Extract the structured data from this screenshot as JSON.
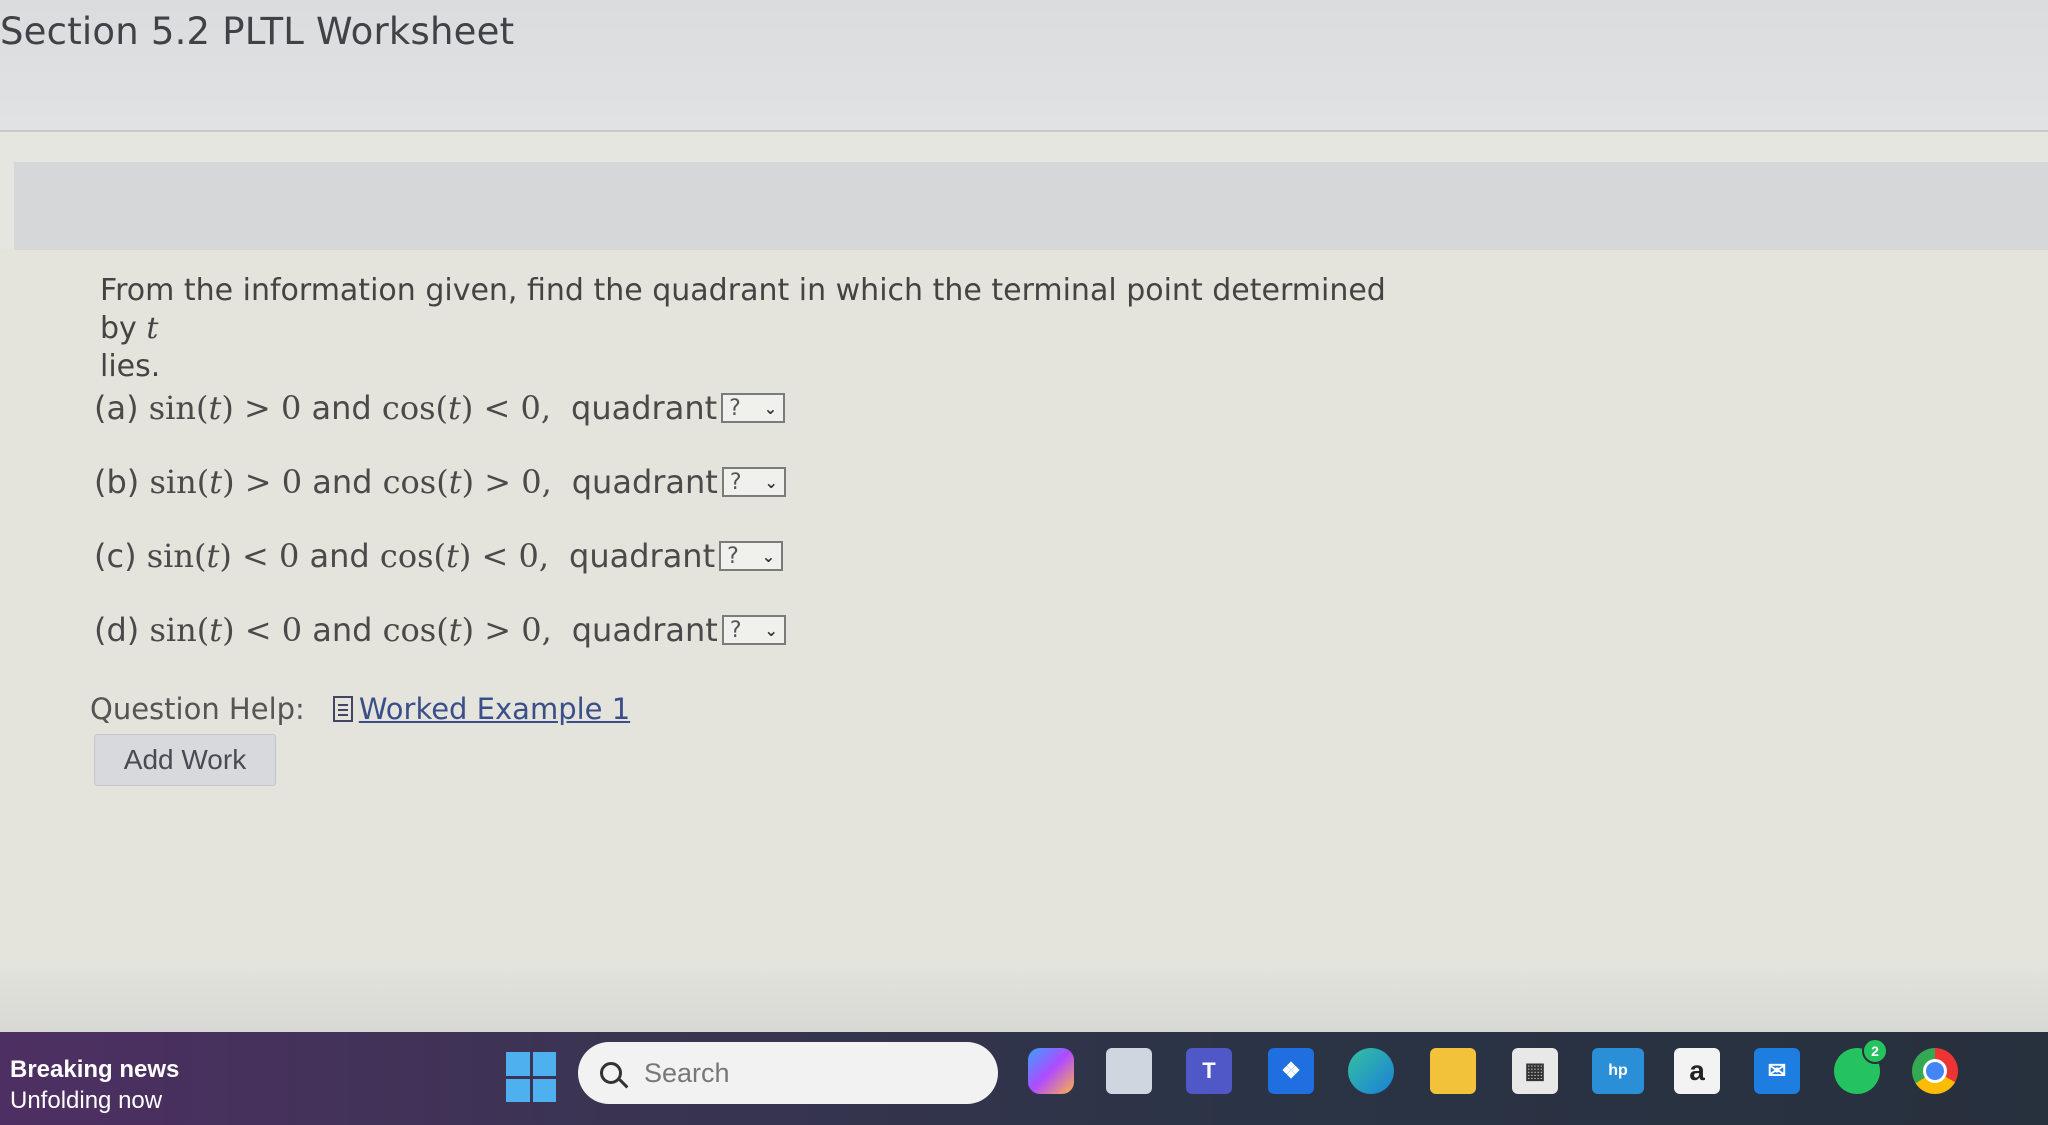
{
  "header": {
    "title": "Section 5.2 PLTL Worksheet"
  },
  "question": {
    "text": "From the information given, find the quadrant in which the terminal point determined by",
    "variable": "t",
    "text_end": "lies."
  },
  "parts": [
    {
      "label": "(a)",
      "sin_rel": ">",
      "cos_rel": "<",
      "quadrant_label": "quadrant",
      "selected": "?"
    },
    {
      "label": "(b)",
      "sin_rel": ">",
      "cos_rel": ">",
      "quadrant_label": "quadrant",
      "selected": "?"
    },
    {
      "label": "(c)",
      "sin_rel": "<",
      "cos_rel": "<",
      "quadrant_label": "quadrant",
      "selected": "?"
    },
    {
      "label": "(d)",
      "sin_rel": "<",
      "cos_rel": ">",
      "quadrant_label": "quadrant",
      "selected": "?"
    }
  ],
  "math": {
    "sin": "sin",
    "cos": "cos",
    "t": "t",
    "zero": "0",
    "and": "and",
    "zero_comma": "0,"
  },
  "help": {
    "label": "Question Help:",
    "link": "Worked Example 1",
    "icon": "document-icon"
  },
  "actions": {
    "add_work": "Add Work"
  },
  "taskbar": {
    "news_title": "Breaking news",
    "news_sub": "Unfolding now",
    "search_placeholder": "Search",
    "apps": [
      "copilot-icon",
      "files-icon",
      "teams-icon",
      "dropbox-icon",
      "edge-icon",
      "file-explorer-icon",
      "store-icon",
      "hp-icon",
      "amazon-icon",
      "mail-icon",
      "whatsapp-icon",
      "chrome-icon"
    ],
    "amazon_letter": "a",
    "whatsapp_badge": "2",
    "colors": {
      "start": "#4fb0f0",
      "accent": "#3a4f8a"
    }
  }
}
